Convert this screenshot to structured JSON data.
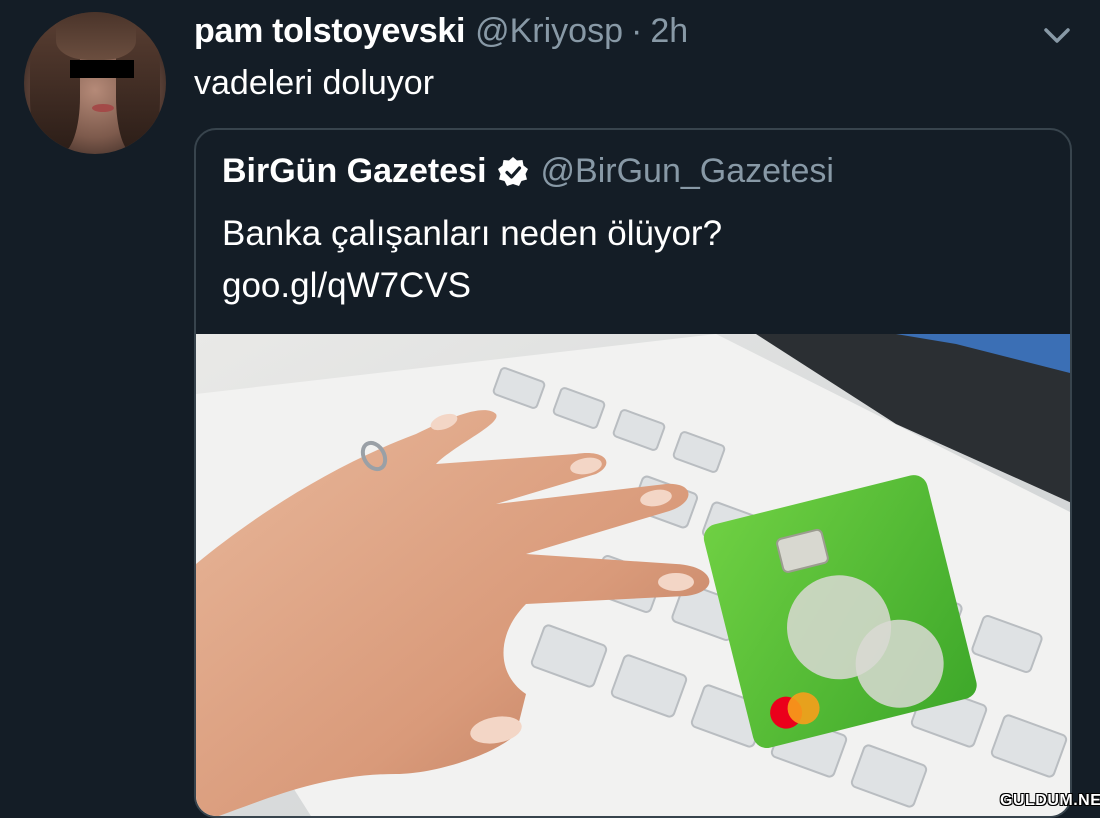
{
  "tweet": {
    "display_name": "pam tolstoyevski",
    "handle": "@Kriyosp",
    "separator": "·",
    "time": "2h",
    "text": "vadeleri doluyor"
  },
  "quoted_tweet": {
    "display_name": "BirGün Gazetesi",
    "handle": "@BirGun_Gazetesi",
    "text_line1": "Banka çalışanları neden ölüyor?",
    "text_line2": "goo.gl/qW7CVS",
    "verified": true
  },
  "icons": {
    "more": "chevron-down-icon",
    "verified": "verified-badge-icon"
  },
  "colors": {
    "background": "#141d26",
    "secondary_text": "#8899a6",
    "border": "#38444d",
    "card_green": "#5cc33a"
  },
  "watermark": "GULDUM.NET"
}
